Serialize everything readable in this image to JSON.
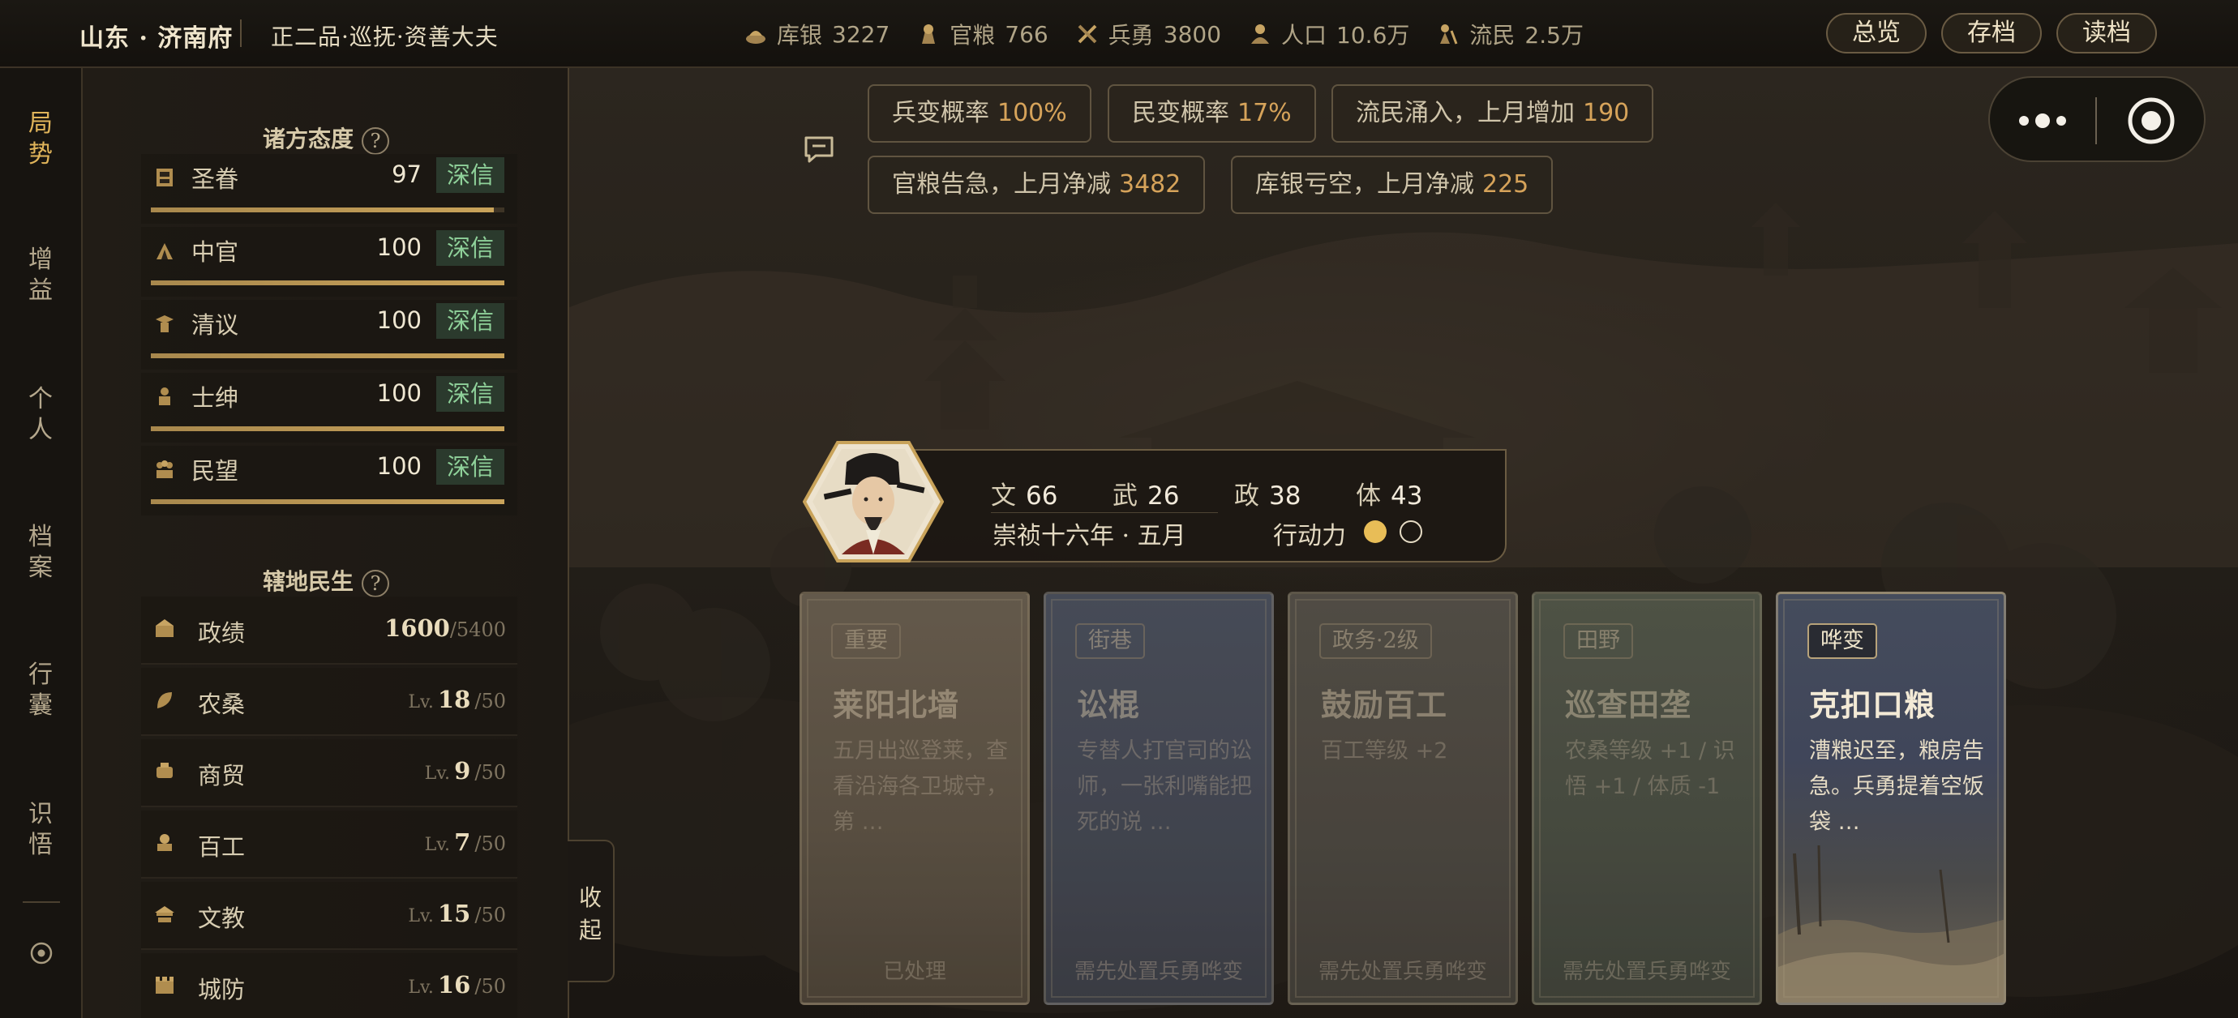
{
  "header": {
    "location": "山东 · 济南府",
    "rank": "正二品·巡抚·资善大夫",
    "resources": [
      {
        "icon": "silver-icon",
        "label": "库银",
        "value": "3227"
      },
      {
        "icon": "grain-icon",
        "label": "官粮",
        "value": "766"
      },
      {
        "icon": "soldier-icon",
        "label": "兵勇",
        "value": "3800"
      },
      {
        "icon": "population-icon",
        "label": "人口",
        "value": "10.6万"
      },
      {
        "icon": "refugee-icon",
        "label": "流民",
        "value": "2.5万"
      }
    ],
    "buttons": {
      "overview": "总览",
      "save": "存档",
      "load": "读档"
    }
  },
  "nav": {
    "items": [
      {
        "label": "局\n势",
        "active": true
      },
      {
        "label": "增\n益"
      },
      {
        "label": "个\n人"
      },
      {
        "label": "档\n案"
      },
      {
        "label": "行\n囊"
      },
      {
        "label": "识\n悟"
      }
    ]
  },
  "panel": {
    "factions_title": "诸方态度",
    "factions": [
      {
        "icon": "throne-icon",
        "name": "圣眷",
        "value": 97,
        "tag": "深信"
      },
      {
        "icon": "eunuch-icon",
        "name": "中官",
        "value": 100,
        "tag": "深信"
      },
      {
        "icon": "scholar-icon",
        "name": "清议",
        "value": 100,
        "tag": "深信"
      },
      {
        "icon": "gentry-icon",
        "name": "士绅",
        "value": 100,
        "tag": "深信"
      },
      {
        "icon": "people-icon",
        "name": "民望",
        "value": 100,
        "tag": "深信"
      }
    ],
    "livelihood_title": "辖地民生",
    "stats": [
      {
        "icon": "merit-icon",
        "name": "政绩",
        "prefix": "",
        "value": "1600",
        "max": "/5400"
      },
      {
        "icon": "farm-icon",
        "name": "农桑",
        "prefix": "Lv.",
        "value": "18",
        "max": "/50"
      },
      {
        "icon": "trade-icon",
        "name": "商贸",
        "prefix": "Lv.",
        "value": "9",
        "max": "/50"
      },
      {
        "icon": "craft-icon",
        "name": "百工",
        "prefix": "Lv.",
        "value": "7",
        "max": "/50"
      },
      {
        "icon": "education-icon",
        "name": "文教",
        "prefix": "Lv.",
        "value": "15",
        "max": "/50"
      },
      {
        "icon": "defense-icon",
        "name": "城防",
        "prefix": "Lv.",
        "value": "16",
        "max": "/50"
      }
    ],
    "collapse": "收\n起"
  },
  "alerts": [
    {
      "label": "兵变概率",
      "value": "100%"
    },
    {
      "label": "民变概率",
      "value": "17%"
    },
    {
      "label": "流民涌入，上月增加",
      "value": "190"
    },
    {
      "label": "官粮告急，上月净减",
      "value": "3482"
    },
    {
      "label": "库银亏空，上月净减",
      "value": "225"
    }
  ],
  "hero": {
    "attributes": [
      {
        "label": "文",
        "value": "66"
      },
      {
        "label": "武",
        "value": "26"
      },
      {
        "label": "政",
        "value": "38"
      },
      {
        "label": "体",
        "value": "43"
      }
    ],
    "date": "崇祯十六年 · 五月",
    "action_label": "行动力",
    "action_points_filled": 1,
    "action_points_total": 2
  },
  "events": [
    {
      "tag": "重要",
      "title": "莱阳北墙",
      "desc": "五月出巡登莱，查看沿海各卫城守，第 …",
      "footer": "已处理",
      "active": false
    },
    {
      "tag": "街巷",
      "title": "讼棍",
      "desc": "专替人打官司的讼师，一张利嘴能把死的说 …",
      "footer": "需先处置兵勇哗变",
      "active": false
    },
    {
      "tag": "政务·2级",
      "title": "鼓励百工",
      "desc": "百工等级 +2",
      "footer": "需先处置兵勇哗变",
      "active": false
    },
    {
      "tag": "田野",
      "title": "巡查田垄",
      "desc": "农桑等级 +1 / 识悟 +1 / 体质 -1",
      "footer": "需先处置兵勇哗变",
      "active": false
    },
    {
      "tag": "哗变",
      "title": "克扣口粮",
      "desc": "漕粮迟至，粮房告急。兵勇提着空饭袋 …",
      "footer": "",
      "active": true
    }
  ],
  "colors": {
    "accent_gold": "#c9a35a",
    "trust_green": "#8fd19a",
    "alert_value": "#d6a35a"
  }
}
